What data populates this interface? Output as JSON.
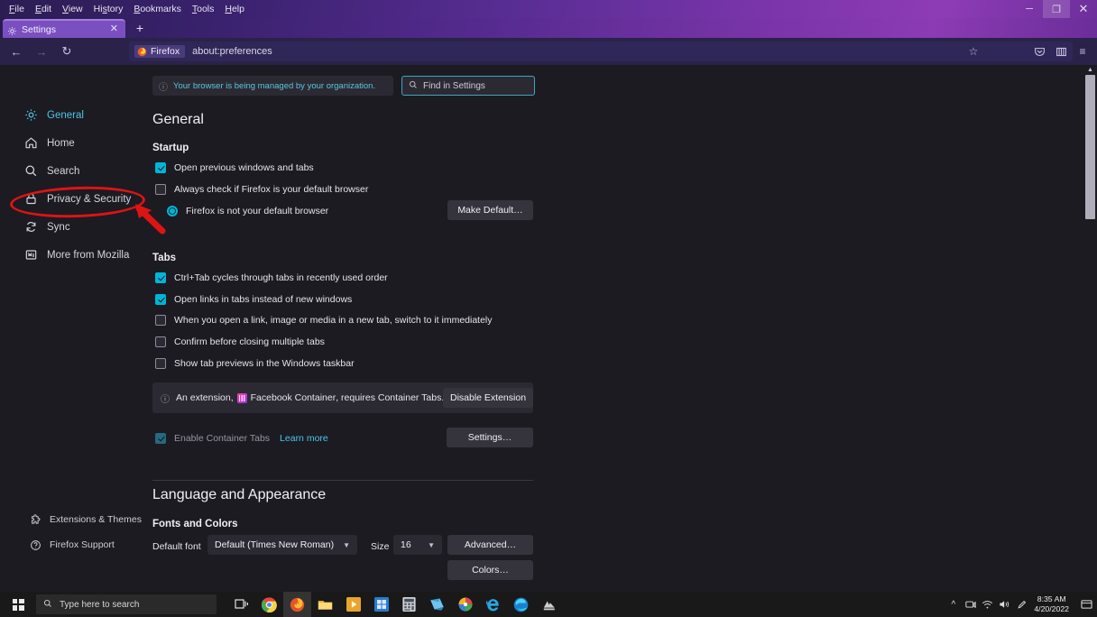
{
  "window": {
    "menubar": [
      {
        "pre": "",
        "accel": "F",
        "post": "ile"
      },
      {
        "pre": "",
        "accel": "E",
        "post": "dit"
      },
      {
        "pre": "",
        "accel": "V",
        "post": "iew"
      },
      {
        "pre": "Hi",
        "accel": "s",
        "post": "tory"
      },
      {
        "pre": "",
        "accel": "B",
        "post": "ookmarks"
      },
      {
        "pre": "",
        "accel": "T",
        "post": "ools"
      },
      {
        "pre": "",
        "accel": "H",
        "post": "elp"
      }
    ],
    "controls": {
      "minimize": "─",
      "maximize": "❐",
      "close": "✕"
    }
  },
  "tabs": {
    "active": {
      "title": "Settings",
      "close_label": "✕"
    },
    "new_tab_label": "+"
  },
  "navbar": {
    "back": "←",
    "forward": "→",
    "reload": "↻",
    "chip_label": "Firefox",
    "url": "about:preferences",
    "bookmark_star": "☆",
    "pocket": "♥",
    "library": "‖",
    "menu": "≡"
  },
  "sidebar": {
    "items": [
      {
        "label": "General",
        "icon": "gear-icon",
        "active": true
      },
      {
        "label": "Home",
        "icon": "home-icon",
        "active": false
      },
      {
        "label": "Search",
        "icon": "search-icon",
        "active": false
      },
      {
        "label": "Privacy & Security",
        "icon": "lock-icon",
        "active": false
      },
      {
        "label": "Sync",
        "icon": "sync-icon",
        "active": false
      },
      {
        "label": "More from Mozilla",
        "icon": "mozilla-icon",
        "active": false
      }
    ],
    "bottom_items": [
      {
        "label": "Extensions & Themes",
        "icon": "puzzle-icon"
      },
      {
        "label": "Firefox Support",
        "icon": "help-icon"
      }
    ]
  },
  "notices": {
    "org_managed": "Your browser is being managed by your organization.",
    "org_icon": "info-icon"
  },
  "search": {
    "placeholder": "Find in Settings",
    "icon": "search-icon"
  },
  "main": {
    "page_title": "General",
    "startup": {
      "heading": "Startup",
      "checkboxes": [
        {
          "label": "Open previous windows and tabs",
          "checked": true
        },
        {
          "label": "Always check if Firefox is your default browser",
          "checked": false
        }
      ],
      "default_status": "Firefox is not your default browser",
      "make_default_button": "Make Default…"
    },
    "tabs_section": {
      "heading": "Tabs",
      "checkboxes": [
        {
          "label": "Ctrl+Tab cycles through tabs in recently used order",
          "checked": true
        },
        {
          "label": "Open links in tabs instead of new windows",
          "checked": true
        },
        {
          "label": "When you open a link, image or media in a new tab, switch to it immediately",
          "checked": false
        },
        {
          "label": "Confirm before closing multiple tabs",
          "checked": false
        },
        {
          "label": "Show tab previews in the Windows taskbar",
          "checked": false
        }
      ],
      "extension_notice": {
        "prefix": "An extension,",
        "extension_name": "Facebook Container",
        "suffix": ", requires Container Tabs.",
        "icon": "facebook-container-icon",
        "button": "Disable Extension"
      },
      "container_tabs": {
        "label": "Enable Container Tabs",
        "checked": true,
        "disabled": true,
        "learn_more": "Learn more",
        "settings_button": "Settings…"
      }
    },
    "language_appearance": {
      "heading": "Language and Appearance",
      "fonts_heading": "Fonts and Colors",
      "default_font_label": "Default font",
      "default_font_value": "Default (Times New Roman)",
      "size_label": "Size",
      "size_value": "16",
      "advanced_button": "Advanced…",
      "colors_button": "Colors…"
    }
  },
  "annotations": {
    "highlight_target": "Privacy & Security",
    "shapes": [
      "red-ellipse",
      "red-arrow"
    ],
    "color": "#dc1414"
  },
  "taskbar": {
    "start_label": "Start",
    "search_placeholder": "Type here to search",
    "search_icon": "search-icon",
    "apps": [
      {
        "name": "task-view-icon"
      },
      {
        "name": "chrome-icon"
      },
      {
        "name": "firefox-icon",
        "active": true
      },
      {
        "name": "file-explorer-icon"
      },
      {
        "name": "media-player-icon"
      },
      {
        "name": "microsoft-store-icon"
      },
      {
        "name": "calculator-icon"
      },
      {
        "name": "sticky-notes-icon"
      },
      {
        "name": "paint-icon"
      },
      {
        "name": "internet-explorer-icon"
      },
      {
        "name": "edge-icon"
      },
      {
        "name": "app-icon"
      }
    ],
    "tray": [
      "chevron-up-icon",
      "onedrive-icon",
      "network-icon",
      "volume-icon",
      "pen-icon"
    ],
    "time": "8:35 AM",
    "date": "4/20/2022",
    "notification_icon": "action-center-icon"
  }
}
